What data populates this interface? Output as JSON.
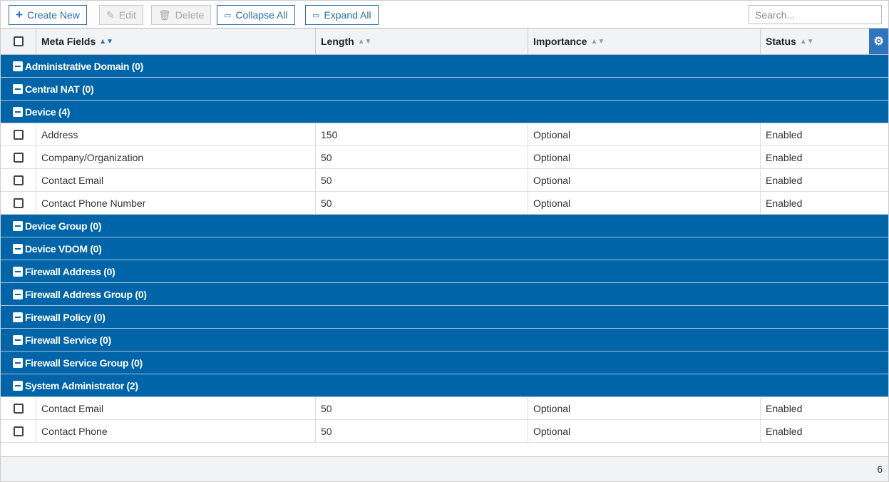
{
  "toolbar": {
    "create": "Create New",
    "edit": "Edit",
    "delete": "Delete",
    "collapse": "Collapse All",
    "expand": "Expand All",
    "search_placeholder": "Search..."
  },
  "columns": {
    "meta": "Meta Fields",
    "length": "Length",
    "importance": "Importance",
    "status": "Status"
  },
  "groups": [
    {
      "label": "Administrative Domain (0)",
      "items": []
    },
    {
      "label": "Central NAT (0)",
      "items": []
    },
    {
      "label": "Device (4)",
      "items": [
        {
          "name": "Address",
          "length": "150",
          "importance": "Optional",
          "status": "Enabled"
        },
        {
          "name": "Company/Organization",
          "length": "50",
          "importance": "Optional",
          "status": "Enabled"
        },
        {
          "name": "Contact Email",
          "length": "50",
          "importance": "Optional",
          "status": "Enabled"
        },
        {
          "name": "Contact Phone Number",
          "length": "50",
          "importance": "Optional",
          "status": "Enabled"
        }
      ]
    },
    {
      "label": "Device Group (0)",
      "items": []
    },
    {
      "label": "Device VDOM (0)",
      "items": []
    },
    {
      "label": "Firewall Address (0)",
      "items": []
    },
    {
      "label": "Firewall Address Group (0)",
      "items": []
    },
    {
      "label": "Firewall Policy (0)",
      "items": []
    },
    {
      "label": "Firewall Service (0)",
      "items": []
    },
    {
      "label": "Firewall Service Group (0)",
      "items": []
    },
    {
      "label": "System Administrator (2)",
      "items": [
        {
          "name": "Contact Email",
          "length": "50",
          "importance": "Optional",
          "status": "Enabled"
        },
        {
          "name": "Contact Phone",
          "length": "50",
          "importance": "Optional",
          "status": "Enabled"
        }
      ]
    }
  ],
  "footer": {
    "count": "6"
  }
}
